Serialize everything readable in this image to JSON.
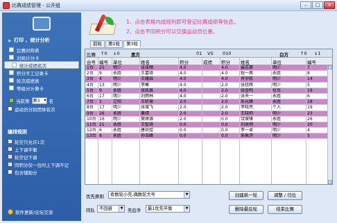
{
  "window": {
    "title": "比赛成绩管理 - 公开组",
    "min": "–",
    "max": "□",
    "close": "×"
  },
  "sidebar": {
    "section_label": "打印 、统计分析",
    "items": [
      {
        "label": "比赛对阵表",
        "active": false
      },
      {
        "label": "对局计分卡",
        "active": false
      },
      {
        "label": "统计成绩名次",
        "active": true
      },
      {
        "label": "积分手工记录卡",
        "active": false
      },
      {
        "label": "轮次成绩表",
        "active": false
      },
      {
        "label": "等级分计算卡",
        "active": false
      }
    ],
    "round_prefix": "当前第",
    "round_value": "第3",
    "round_suffix": "名",
    "athlete_stats": "运动员分别团体名次",
    "rules_label": "编排规则",
    "rules": [
      {
        "label": "轮空只允许1次",
        "checked": true
      },
      {
        "label": "上下调平衡",
        "checked": true
      },
      {
        "label": "轮空记下调",
        "checked": true
      },
      {
        "label": "同积分仅一位时上下调不记",
        "checked": true
      },
      {
        "label": "包含辅助分",
        "checked": false
      }
    ],
    "footer": "软件更新/论坛交流"
  },
  "hints": {
    "line1": "1、点击表格内成绩列即可登记比赛成绩等信息。",
    "line2": "2、点击不同积分可以交换运动员位置。"
  },
  "tabs": [
    {
      "label": "前轮",
      "active": false
    },
    {
      "label": "第1轮",
      "active": false
    },
    {
      "label": "第3轮",
      "active": true
    }
  ],
  "grid": {
    "title": {
      "match": "比赛",
      "up": "↑0",
      "down": "↓0",
      "black": "黑方",
      "count_left": "01",
      "vs": "VS",
      "count_right": "010",
      "white": "白方",
      "up2": "↑0",
      "down2": "↓1"
    },
    "headers": [
      "台号",
      "编号",
      "单位",
      "姓名",
      "积分",
      "成绩",
      "积分",
      "姓名",
      "单位",
      "编号"
    ],
    "rows": [
      {
        "table": "1台",
        "no": "25",
        "unit": "明少",
        "name": "张泽翔",
        "score": "4.0",
        "result": "",
        "score2": "4.0",
        "name2": "聂志豪",
        "unit2": "明少",
        "no2": "7"
      },
      {
        "table": "2台",
        "no": "9",
        "unit": "永胜",
        "name": "王嘉铎",
        "score": "4.0",
        "result": "",
        "score2": "4.0",
        "name2": "程一茜",
        "unit2": "永胜",
        "no2": "8"
      },
      {
        "table": "3台",
        "no": "4",
        "unit": "明少",
        "name": "王耀霖",
        "score": "4.0",
        "result": "",
        "score2": "4.0",
        "name2": "肖宇航",
        "unit2": "明少",
        "no2": "14"
      },
      {
        "table": "4台",
        "no": "13",
        "unit": "明少",
        "name": "李聚",
        "score": "4.0",
        "result": "",
        "score2": "2.0",
        "name2": "张轻辉",
        "unit2": "明少",
        "no2": "5"
      },
      {
        "table": "5台",
        "no": "9",
        "unit": "永胜",
        "name": "张凯晨",
        "score": "4.0",
        "result": "",
        "score2": "2.0",
        "name2": "张金鸣",
        "unit2": "化东",
        "no2": "19"
      },
      {
        "table": "6台",
        "no": "17",
        "unit": "明少",
        "name": "刘雨林",
        "score": "4.0",
        "result": "",
        "score2": "2.0",
        "name2": "张天一",
        "unit2": "永胜",
        "no2": "6"
      },
      {
        "table": "7台",
        "no": "1",
        "unit": "辽阳",
        "name": "王昕瑜",
        "score": "2.0",
        "result": "",
        "score2": "2.0",
        "name2": "朱元峰",
        "unit2": "永胜",
        "no2": "18"
      },
      {
        "table": "8台",
        "no": "17",
        "unit": "明少",
        "name": "张增飞",
        "score": "2.0",
        "result": "",
        "score2": "2.0",
        "name2": "李晓亮",
        "unit2": "个人",
        "no2": "19"
      },
      {
        "table": "9台",
        "no": "26",
        "unit": "永胜",
        "name": "栗靖",
        "score": "2.0",
        "result": "",
        "score2": "2.0",
        "name2": "王晓帅",
        "unit2": "明少",
        "no2": "23"
      },
      {
        "table": "10台",
        "no": "16",
        "unit": "明少",
        "name": "樊峥源",
        "score": "2.0",
        "result": "",
        "score2": "0.0",
        "name2": "饶保锋",
        "unit2": "永胜",
        "no2": "26"
      },
      {
        "table": "11台",
        "no": "21",
        "unit": "永胜",
        "name": "王智琦",
        "score": "0.0",
        "result": "",
        "score2": "0.0",
        "name2": "刘熹明",
        "unit2": "明少",
        "no2": "20"
      },
      {
        "table": "12台",
        "no": "6",
        "unit": "永胜",
        "name": "唐祯煜",
        "score": "0.0",
        "result": "",
        "score2": "0.0",
        "name2": "李一卓",
        "unit2": "明少",
        "no2": "4"
      },
      {
        "table": "13台",
        "no": "8",
        "unit": "永胜",
        "name": "孙浩峰",
        "score": "0.0",
        "result": "",
        "score2": "0.0",
        "name2": "吴乘济",
        "unit2": "明少",
        "no2": "5"
      }
    ]
  },
  "bottom": {
    "priority_label": "优先原则",
    "priority_value": "奇数轮小先,偶数轮大号",
    "same_label": "同队",
    "same_value": "不回避",
    "first_label": "先后手",
    "first_value": "最1优先平衡",
    "btn_create": "创建新一轮",
    "btn_adjust": "调整 / 归位",
    "btn_delete": "删除最后轮",
    "btn_end": "结束比赛"
  },
  "colors": {
    "pink_row": "#c88ac6",
    "hint": "#e33a8d",
    "sidebar": "#2f62ac"
  }
}
